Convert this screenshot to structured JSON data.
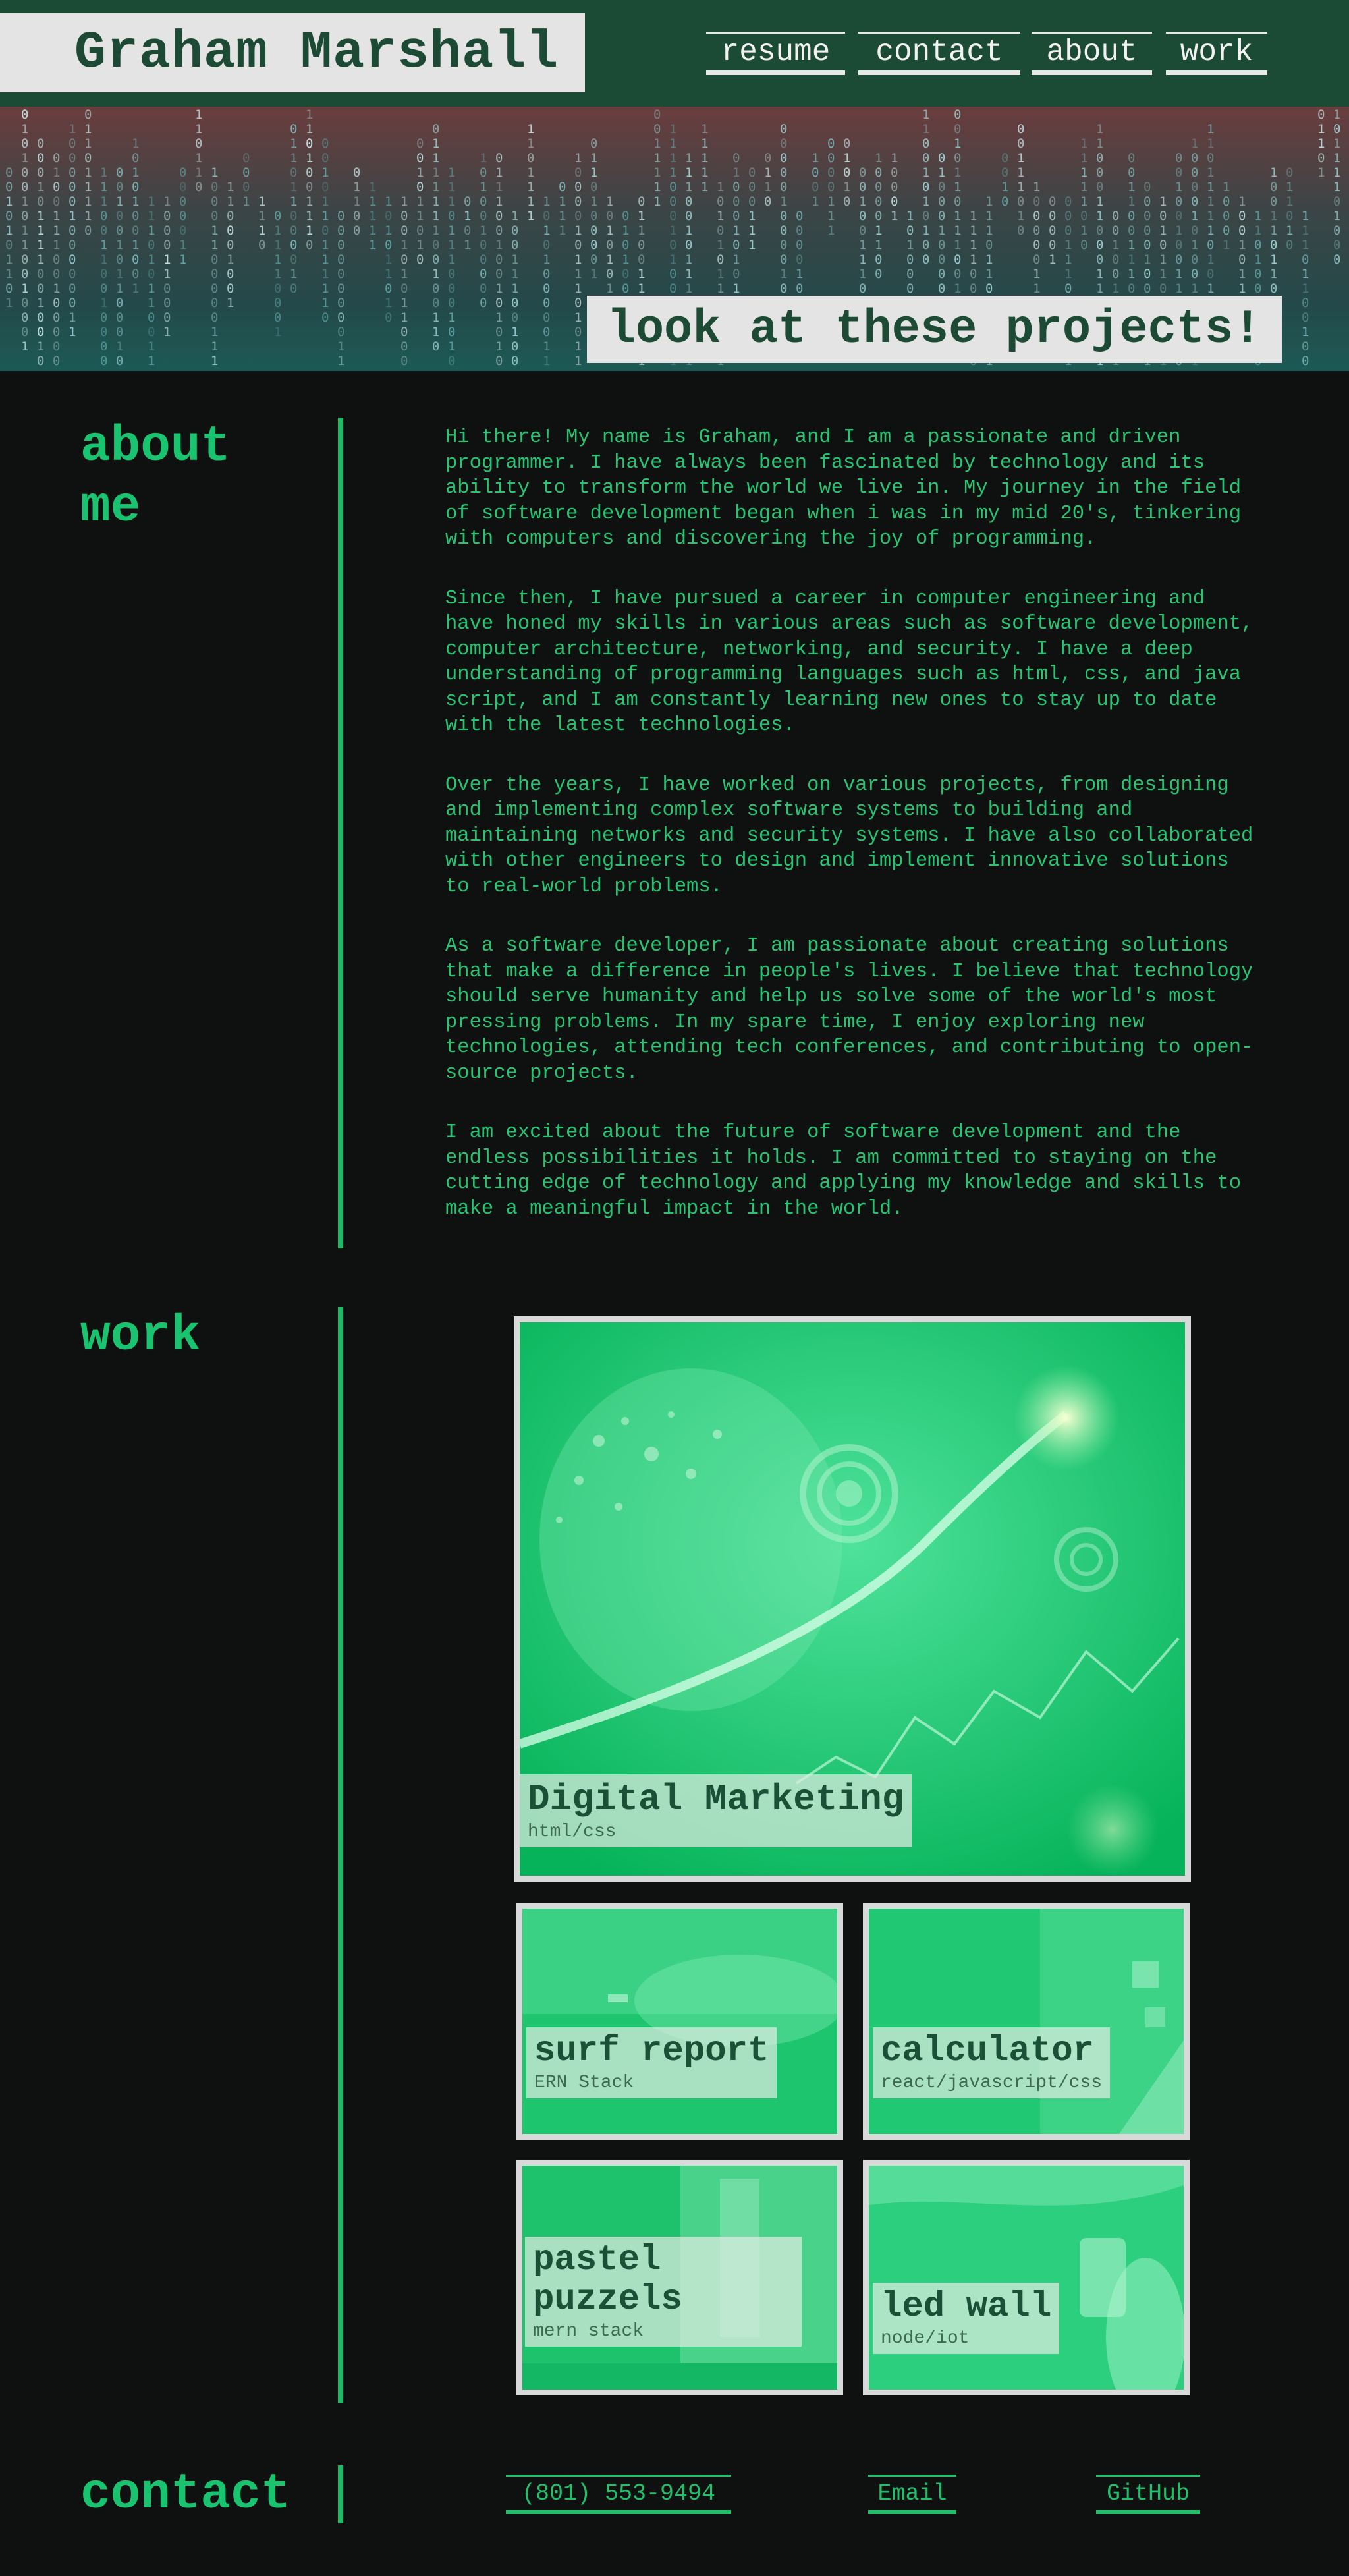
{
  "header": {
    "name": "Graham Marshall",
    "nav": [
      "resume",
      "contact",
      "about",
      "work"
    ]
  },
  "hero": {
    "banner": "look at these projects!"
  },
  "about": {
    "title_line1": "about",
    "title_line2": "me",
    "paragraphs": [
      "Hi there! My name is Graham, and I am a passionate and driven programmer. I have always been fascinated by technology and its ability to transform the world we live in. My journey in the field of software development began when i was in my mid 20's, tinkering with computers and discovering the joy of programming.",
      "Since then, I have pursued a career in computer engineering and have honed my skills in various areas such as software development, computer architecture, networking, and security. I have a deep understanding of programming languages such as html, css, and java script, and I am constantly learning new ones to stay up to date with the latest technologies.",
      "Over the years, I have worked on various projects, from designing and implementing complex software systems to building and maintaining networks and security systems. I have also collaborated with other engineers to design and implement innovative solutions to real-world problems.",
      "As a software developer, I am passionate about creating solutions that make a difference in people's lives. I believe that technology should serve humanity and help us solve some of the world's most pressing problems. In my spare time, I enjoy exploring new technologies, attending tech conferences, and contributing to open-source projects.",
      "I am excited about the future of software development and the endless possibilities it holds. I am committed to staying on the cutting edge of technology and applying my knowledge and skills to make a meaningful impact in the world."
    ]
  },
  "work": {
    "title": "work",
    "projects": [
      {
        "title": "Digital Marketing",
        "stack": "html/css"
      },
      {
        "title": "surf report",
        "stack": "ERN Stack"
      },
      {
        "title": "calculator",
        "stack": "react/javascript/css"
      },
      {
        "title": "pastel puzzels",
        "stack": "mern stack"
      },
      {
        "title": "led wall",
        "stack": "node/iot"
      }
    ]
  },
  "contact": {
    "title": "contact",
    "links": [
      "(801) 553-9494",
      "Email",
      "GitHub"
    ]
  },
  "colors": {
    "header_bg": "#1b4a35",
    "page_bg": "#0f1110",
    "accent_green": "#19c36f",
    "plate_bg": "#e4e4e4"
  }
}
